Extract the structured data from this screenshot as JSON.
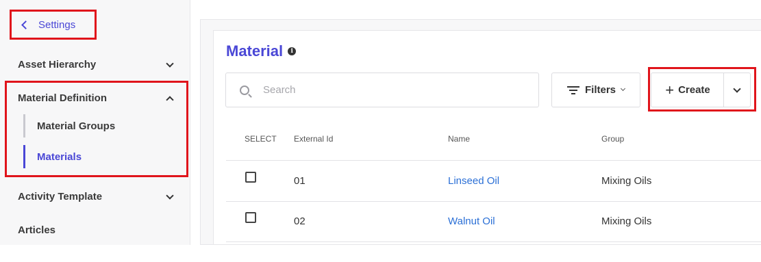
{
  "sidebar": {
    "back_label": "Settings",
    "items": [
      {
        "label": "Asset Hierarchy"
      },
      {
        "label": "Material Definition"
      },
      {
        "label": "Activity Template"
      },
      {
        "label": "Articles"
      }
    ],
    "sub_items": [
      {
        "label": "Material Groups"
      },
      {
        "label": "Materials"
      }
    ]
  },
  "main": {
    "title": "Material",
    "search": {
      "placeholder": "Search"
    },
    "filters_label": "Filters",
    "create_label": "Create",
    "table": {
      "headers": [
        "SELECT",
        "External Id",
        "Name",
        "Group"
      ],
      "rows": [
        {
          "external_id": "01",
          "name": "Linseed Oil",
          "group": "Mixing Oils"
        },
        {
          "external_id": "02",
          "name": "Walnut Oil",
          "group": "Mixing Oils"
        }
      ]
    }
  },
  "colors": {
    "accent": "#4a47d6",
    "link": "#2a6fd6",
    "highlight_border": "#e0141b"
  }
}
